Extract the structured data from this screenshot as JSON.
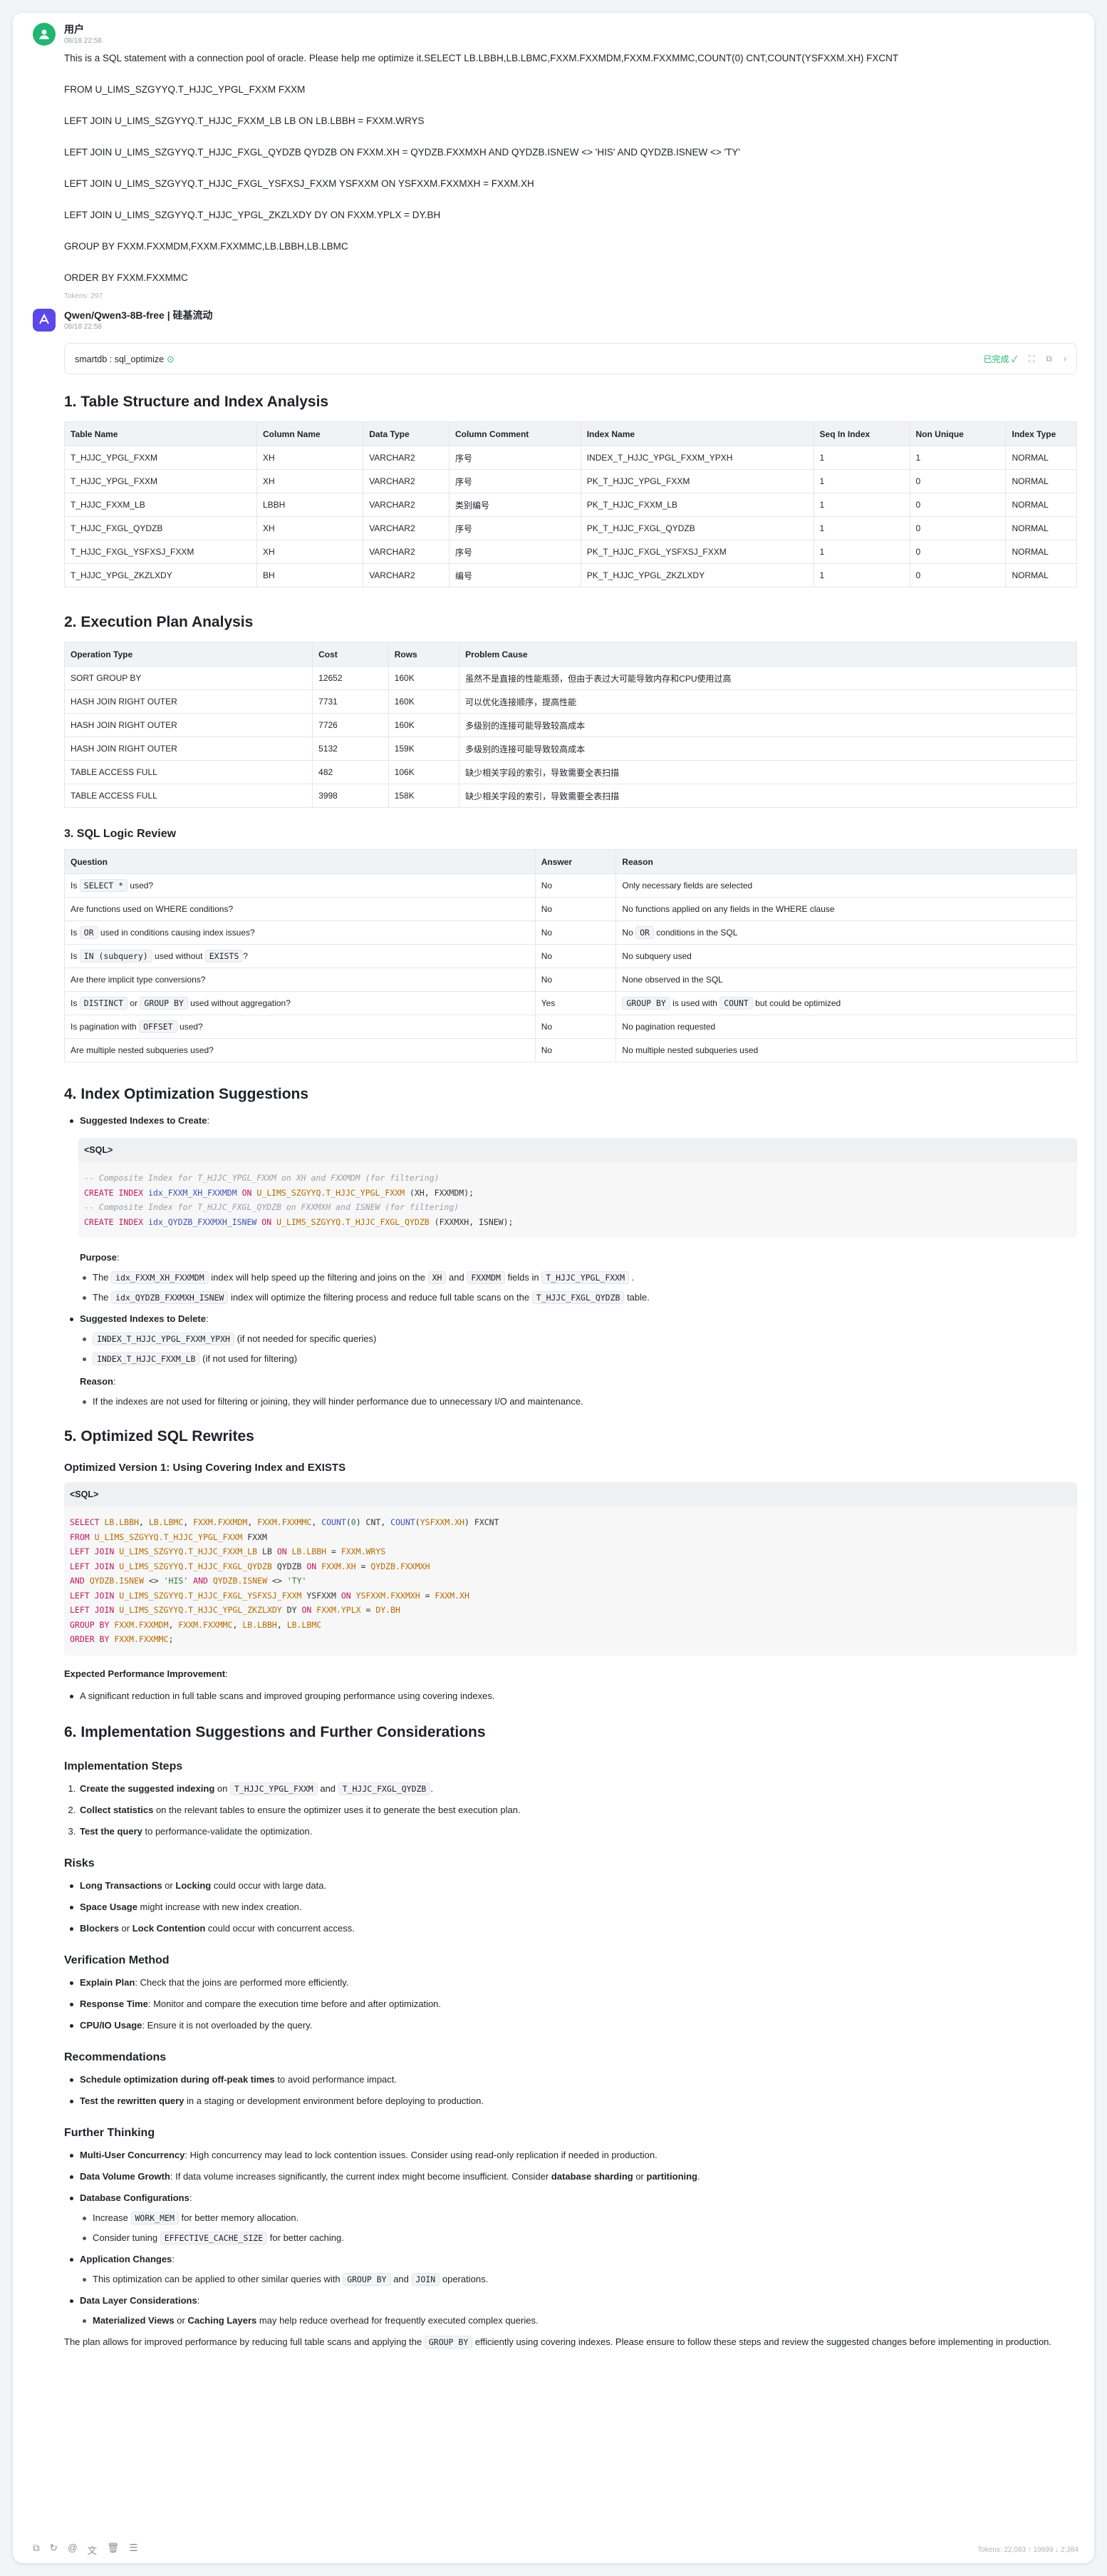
{
  "user": {
    "name": "用户",
    "time": "08/18 22:58",
    "tokens": "Tokens: 297",
    "lines": [
      "This is a SQL statement with a connection pool of oracle. Please help me optimize it.SELECT LB.LBBH,LB.LBMC,FXXM.FXXMDM,FXXM.FXXMMC,COUNT(0) CNT,COUNT(YSFXXM.XH) FXCNT",
      "FROM U_LIMS_SZGYYQ.T_HJJC_YPGL_FXXM FXXM",
      "LEFT JOIN U_LIMS_SZGYYQ.T_HJJC_FXXM_LB LB ON LB.LBBH = FXXM.WRYS",
      "LEFT JOIN U_LIMS_SZGYYQ.T_HJJC_FXGL_QYDZB QYDZB ON FXXM.XH = QYDZB.FXXMXH  AND QYDZB.ISNEW <> 'HIS' AND QYDZB.ISNEW <> 'TY'",
      "LEFT JOIN U_LIMS_SZGYYQ.T_HJJC_FXGL_YSFXSJ_FXXM YSFXXM ON YSFXXM.FXXMXH = FXXM.XH",
      "LEFT JOIN U_LIMS_SZGYYQ.T_HJJC_YPGL_ZKZLXDY DY ON FXXM.YPLX = DY.BH",
      "GROUP BY FXXM.FXXMDM,FXXM.FXXMMC,LB.LBBH,LB.LBMC",
      "ORDER BY FXXM.FXXMMC"
    ]
  },
  "bot": {
    "name": "Qwen/Qwen3-8B-free | 硅基流动",
    "time": "08/18 22:58",
    "footer_tokens": "Tokens: 22,083 ↑ 19699 ↓ 2,384"
  },
  "tool": {
    "name": "smartdb : sql_optimize",
    "status": "已完成 ✓"
  },
  "s1": {
    "title": "1. Table Structure and Index Analysis",
    "headers": [
      "Table Name",
      "Column Name",
      "Data Type",
      "Column Comment",
      "Index Name",
      "Seq In Index",
      "Non Unique",
      "Index Type"
    ],
    "rows": [
      [
        "T_HJJC_YPGL_FXXM",
        "XH",
        "VARCHAR2",
        "序号",
        "INDEX_T_HJJC_YPGL_FXXM_YPXH",
        "1",
        "1",
        "NORMAL"
      ],
      [
        "T_HJJC_YPGL_FXXM",
        "XH",
        "VARCHAR2",
        "序号",
        "PK_T_HJJC_YPGL_FXXM",
        "1",
        "0",
        "NORMAL"
      ],
      [
        "T_HJJC_FXXM_LB",
        "LBBH",
        "VARCHAR2",
        "类别编号",
        "PK_T_HJJC_FXXM_LB",
        "1",
        "0",
        "NORMAL"
      ],
      [
        "T_HJJC_FXGL_QYDZB",
        "XH",
        "VARCHAR2",
        "序号",
        "PK_T_HJJC_FXGL_QYDZB",
        "1",
        "0",
        "NORMAL"
      ],
      [
        "T_HJJC_FXGL_YSFXSJ_FXXM",
        "XH",
        "VARCHAR2",
        "序号",
        "PK_T_HJJC_FXGL_YSFXSJ_FXXM",
        "1",
        "0",
        "NORMAL"
      ],
      [
        "T_HJJC_YPGL_ZKZLXDY",
        "BH",
        "VARCHAR2",
        "编号",
        "PK_T_HJJC_YPGL_ZKZLXDY",
        "1",
        "0",
        "NORMAL"
      ]
    ]
  },
  "s2": {
    "title": "2. Execution Plan Analysis",
    "headers": [
      "Operation Type",
      "Cost",
      "Rows",
      "Problem Cause"
    ],
    "rows": [
      [
        "SORT GROUP BY",
        "12652",
        "160K",
        "虽然不是直接的性能瓶颈，但由于表过大可能导致内存和CPU使用过高"
      ],
      [
        "HASH JOIN RIGHT OUTER",
        "7731",
        "160K",
        "可以优化连接顺序，提高性能"
      ],
      [
        "HASH JOIN RIGHT OUTER",
        "7726",
        "160K",
        "多级别的连接可能导致较高成本"
      ],
      [
        "HASH JOIN RIGHT OUTER",
        "5132",
        "159K",
        "多级别的连接可能导致较高成本"
      ],
      [
        "TABLE ACCESS FULL",
        "482",
        "106K",
        "缺少相关字段的索引，导致需要全表扫描"
      ],
      [
        "TABLE ACCESS FULL",
        "3998",
        "158K",
        "缺少相关字段的索引，导致需要全表扫描"
      ]
    ]
  },
  "s3": {
    "title": "3. SQL Logic Review",
    "headers": [
      "Question",
      "Answer",
      "Reason"
    ],
    "rows": [
      [
        "Is |SELECT *| used?",
        "No",
        "Only necessary fields are selected"
      ],
      [
        "Are functions used on WHERE conditions?",
        "No",
        "No functions applied on any fields in the WHERE clause"
      ],
      [
        "Is |OR| used in conditions causing index issues?",
        "No",
        "No |OR| conditions in the SQL"
      ],
      [
        "Is |IN (subquery)| used without |EXISTS|?",
        "No",
        "No subquery used"
      ],
      [
        "Are there implicit type conversions?",
        "No",
        "None observed in the SQL"
      ],
      [
        "Is |DISTINCT| or |GROUP BY| used without aggregation?",
        "Yes",
        "|GROUP BY| is used with |COUNT| but could be optimized"
      ],
      [
        "Is pagination with |OFFSET| used?",
        "No",
        "No pagination requested"
      ],
      [
        "Are multiple nested subqueries used?",
        "No",
        "No multiple nested subqueries used"
      ]
    ]
  },
  "s4": {
    "title": "4. Index Optimization Suggestions",
    "create_label": "Suggested Indexes to Create",
    "code_label": "<SQL>",
    "purpose_label": "Purpose",
    "purpose": [
      [
        "The",
        "idx_FXXM_XH_FXXMDM",
        "index will help speed up the filtering and joins on the",
        "XH",
        "and",
        "FXXMDM",
        "fields in",
        "T_HJJC_YPGL_FXXM",
        "."
      ],
      [
        "The",
        "idx_QYDZB_FXXMXH_ISNEW",
        "index will optimize the filtering process and reduce full table scans on the",
        "T_HJJC_FXGL_QYDZB",
        "table."
      ]
    ],
    "delete_label": "Suggested Indexes to Delete",
    "deletes": [
      [
        "INDEX_T_HJJC_YPGL_FXXM_YPXH",
        "(if not needed for specific queries)"
      ],
      [
        "INDEX_T_HJJC_FXXM_LB",
        "(if not used for filtering)"
      ]
    ],
    "reason_label": "Reason",
    "reason": "If the indexes are not used for filtering or joining, they will hinder performance due to unnecessary I/O and maintenance."
  },
  "s5": {
    "title": "5. Optimized SQL Rewrites",
    "sub": "Optimized Version 1: Using Covering Index and EXISTS",
    "code_label": "<SQL>",
    "perf_label": "Expected Performance Improvement",
    "perf": "A significant reduction in full table scans and improved grouping performance using covering indexes."
  },
  "s6": {
    "title": "6. Implementation Suggestions and Further Considerations",
    "impl_title": "Implementation Steps",
    "impl": [
      [
        "Create the suggested indexing",
        " on ",
        "T_HJJC_YPGL_FXXM",
        " and ",
        "T_HJJC_FXGL_QYDZB",
        "."
      ],
      [
        "Collect statistics",
        " on the relevant tables to ensure the optimizer uses it to generate the best execution plan."
      ],
      [
        "Test the query",
        " to performance-validate the optimization."
      ]
    ],
    "risks_title": "Risks",
    "risks": [
      [
        "Long Transactions",
        " or ",
        "Locking",
        " could occur with large data."
      ],
      [
        "Space Usage",
        " might increase with new index creation."
      ],
      [
        "Blockers",
        " or ",
        "Lock Contention",
        " could occur with concurrent access."
      ]
    ],
    "verify_title": "Verification Method",
    "verify": [
      [
        "Explain Plan",
        ": Check that the joins are performed more efficiently."
      ],
      [
        "Response Time",
        ": Monitor and compare the execution time before and after optimization."
      ],
      [
        "CPU/IO Usage",
        ": Ensure it is not overloaded by the query."
      ]
    ],
    "rec_title": "Recommendations",
    "rec": [
      [
        "Schedule optimization during off-peak times",
        " to avoid performance impact."
      ],
      [
        "Test the rewritten query",
        " in a staging or development environment before deploying to production."
      ]
    ],
    "ft_title": "Further Thinking",
    "ft1": [
      "Multi-User Concurrency",
      ": High concurrency may lead to lock contention issues. Consider using read-only replication if needed in production."
    ],
    "ft2": [
      "Data Volume Growth",
      ": If data volume increases significantly, the current index might become insufficient. Consider ",
      "database sharding",
      " or ",
      "partitioning",
      "."
    ],
    "ft3": "Database Configurations",
    "ft3a": [
      "Increase",
      "WORK_MEM",
      "for better memory allocation."
    ],
    "ft3b": [
      "Consider tuning",
      "EFFECTIVE_CACHE_SIZE",
      "for better caching."
    ],
    "ft4": "Application Changes",
    "ft4a": [
      "This optimization can be applied to other similar queries with",
      "GROUP BY",
      "and",
      "JOIN",
      "operations."
    ],
    "ft5": "Data Layer Considerations",
    "ft5a": [
      "Materialized Views",
      " or ",
      "Caching Layers",
      " may help reduce overhead for frequently executed complex queries."
    ],
    "final": [
      "The plan allows for improved performance by reducing full table scans and applying the",
      "GROUP BY",
      "efficiently using covering indexes. Please ensure to follow these steps and review the suggested changes before implementing in production."
    ]
  }
}
